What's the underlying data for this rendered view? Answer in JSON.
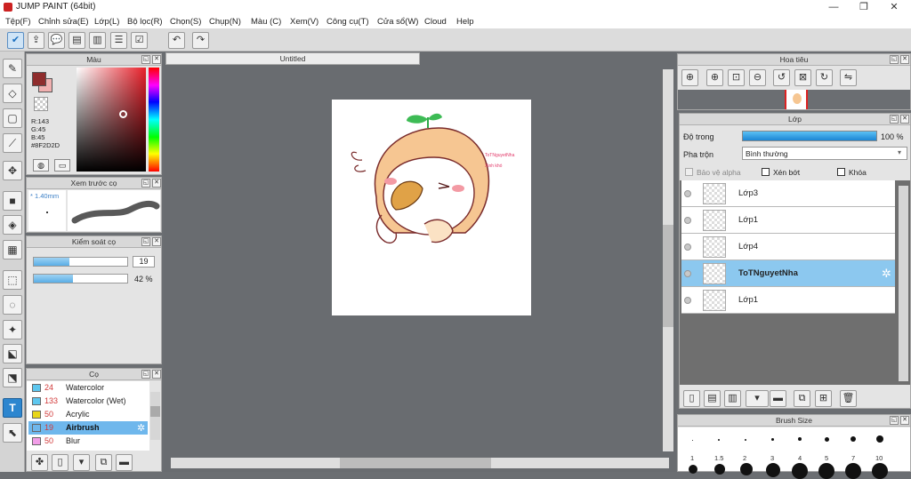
{
  "window": {
    "title": "JUMP PAINT (64bit)"
  },
  "menu": [
    "Tệp(F)",
    "Chỉnh sửa(E)",
    "Lớp(L)",
    "Bộ lọc(R)",
    "Chọn(S)",
    "Chụp(N)",
    "Màu (C)",
    "Xem(V)",
    "Công cụ(T)",
    "Cửa sổ(W)",
    "Cloud",
    "Help"
  ],
  "canvas": {
    "tab_title": "Untitled",
    "art_text_1": "ToTNguyetNha",
    "art_text_2": "Xinh khó"
  },
  "color_panel": {
    "title": "Màu",
    "r": "R:143",
    "g": "G:45",
    "b": "B:45",
    "hex": "#8F2D2D",
    "primary": "#8f2d2d",
    "secondary": "#f1b0b0"
  },
  "preview_panel": {
    "title": "Xem trước cọ",
    "size_label": "* 1.40mm"
  },
  "control_panel": {
    "title": "Kiểm soát cọ",
    "size_value": "19",
    "opacity_value": "42 %"
  },
  "brush_panel": {
    "title": "Cọ",
    "items": [
      {
        "num": "24",
        "label": "Watercolor",
        "color": "#5ec7ef"
      },
      {
        "num": "133",
        "label": "Watercolor (Wet)",
        "color": "#5ec7ef"
      },
      {
        "num": "50",
        "label": "Acrylic",
        "color": "#e8d61a"
      },
      {
        "num": "19",
        "label": "Airbrush",
        "color": "#6fb7ec"
      },
      {
        "num": "50",
        "label": "Blur",
        "color": "#f29ee8"
      }
    ]
  },
  "navigator": {
    "title": "Hoa tiêu"
  },
  "layer_panel": {
    "title": "Lớp",
    "opacity_label": "Độ trong",
    "opacity_value": "100 %",
    "blend_label": "Pha trộn",
    "blend_value": "Bình thường",
    "protect_alpha": "Bảo vệ alpha",
    "clipping": "Xén bớt",
    "lock": "Khóa",
    "layers": [
      "Lớp3",
      "Lớp1",
      "Lớp4",
      "ToTNguyetNha",
      "Lớp1"
    ]
  },
  "brush_size_panel": {
    "title": "Brush Size",
    "labels": [
      "1",
      "1.5",
      "2",
      "3",
      "4",
      "5",
      "7",
      "10"
    ]
  }
}
